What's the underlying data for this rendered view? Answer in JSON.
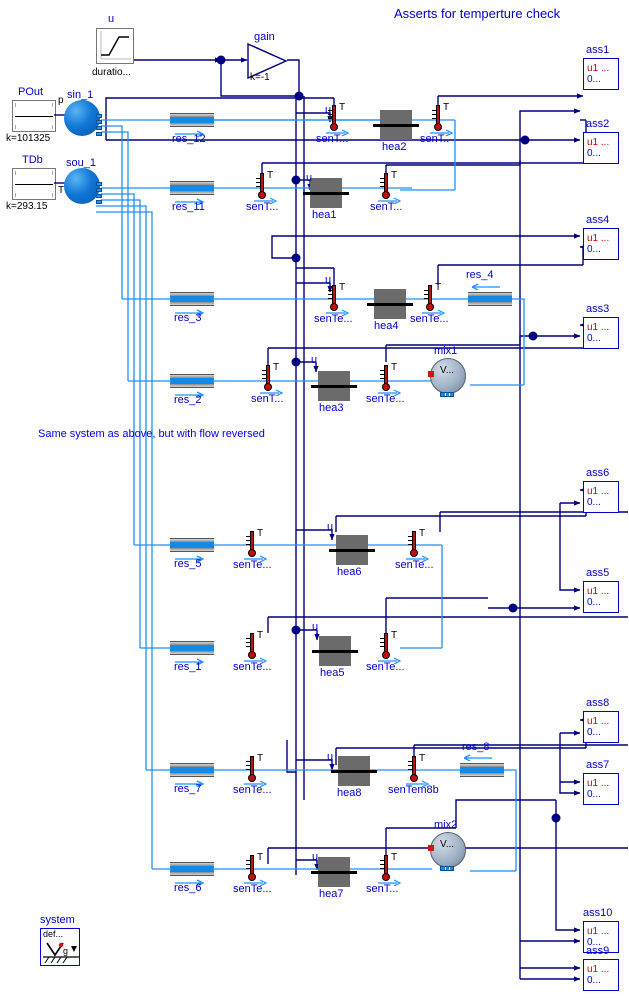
{
  "diagram": {
    "title": "Asserts for temperture check",
    "annotation": "Same system as above, but with flow reversed",
    "bg_color": "#ffffff",
    "label_color": "#0000d0",
    "signal_wire_color": "#000080",
    "fluid_wire_color": "#1e90ff"
  },
  "sources": [
    {
      "name": "POut",
      "param": "k=101325"
    },
    {
      "name": "TDb",
      "param": "k=293.15"
    }
  ],
  "ramp": {
    "name": "u",
    "param": "duratio..."
  },
  "gain": {
    "name": "gain",
    "param": "k=-1"
  },
  "boundaries": [
    {
      "name": "sin_1",
      "port": "p"
    },
    {
      "name": "sou_1",
      "port": "T"
    }
  ],
  "resistances": [
    {
      "name": "res_12",
      "flow": "right"
    },
    {
      "name": "res_11",
      "flow": "right"
    },
    {
      "name": "res_3",
      "flow": "right"
    },
    {
      "name": "res_2",
      "flow": "right"
    },
    {
      "name": "res_4",
      "flow": "left"
    },
    {
      "name": "res_5",
      "flow": "right"
    },
    {
      "name": "res_1",
      "flow": "right"
    },
    {
      "name": "res_7",
      "flow": "right"
    },
    {
      "name": "res_6",
      "flow": "right"
    },
    {
      "name": "res_8",
      "flow": "left"
    }
  ],
  "heaters": [
    {
      "name": "hea2",
      "input": "u"
    },
    {
      "name": "hea1",
      "input": "u"
    },
    {
      "name": "hea4",
      "input": "u"
    },
    {
      "name": "hea3",
      "input": "u"
    },
    {
      "name": "hea6",
      "input": "u"
    },
    {
      "name": "hea5",
      "input": "u"
    },
    {
      "name": "hea8",
      "input": "u"
    },
    {
      "name": "hea7",
      "input": "u"
    }
  ],
  "sensors": [
    {
      "name": "senT...",
      "port": "T"
    },
    {
      "name": "senT..",
      "port": "T"
    },
    {
      "name": "senT...",
      "port": "T"
    },
    {
      "name": "senT...",
      "port": "T"
    },
    {
      "name": "senTe...",
      "port": "T"
    },
    {
      "name": "senTe...",
      "port": "T"
    },
    {
      "name": "senT...",
      "port": "T"
    },
    {
      "name": "senTe...",
      "port": "T"
    },
    {
      "name": "senTe...",
      "port": "T"
    },
    {
      "name": "senTe...",
      "port": "T"
    },
    {
      "name": "senTe...",
      "port": "T"
    },
    {
      "name": "senTe...",
      "port": "T"
    },
    {
      "name": "senTe...",
      "port": "T"
    },
    {
      "name": "senTem8b",
      "port": "T"
    },
    {
      "name": "senTe...",
      "port": "T"
    },
    {
      "name": "senT...",
      "port": "T"
    }
  ],
  "volumes": [
    {
      "name": "mix1",
      "glyph": "V..."
    },
    {
      "name": "mix2",
      "glyph": "V..."
    }
  ],
  "asserts": [
    {
      "name": "ass1",
      "u1": "u1 ...",
      "u2": "0..."
    },
    {
      "name": "ass2",
      "u1": "u1 ...",
      "u2": "0..."
    },
    {
      "name": "ass4",
      "u1": "u1 ...",
      "u2": "0..."
    },
    {
      "name": "ass3",
      "u1": "u1 ...",
      "u2": "0..."
    },
    {
      "name": "ass6",
      "u1": "u1 ...",
      "u2": "0..."
    },
    {
      "name": "ass5",
      "u1": "u1 ...",
      "u2": "0..."
    },
    {
      "name": "ass8",
      "u1": "u1 ...",
      "u2": "0..."
    },
    {
      "name": "ass7",
      "u1": "u1 ...",
      "u2": "0..."
    },
    {
      "name": "ass10",
      "u1": "u1 ...",
      "u2": "0..."
    },
    {
      "name": "ass9",
      "u1": "u1 ...",
      "u2": "0..."
    }
  ],
  "system": {
    "name": "system",
    "param": "def..."
  }
}
